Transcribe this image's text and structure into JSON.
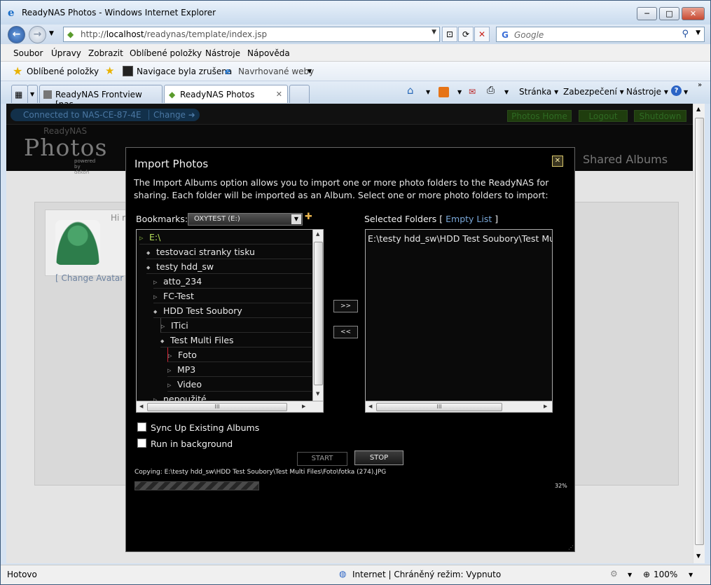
{
  "window": {
    "title": "ReadyNAS Photos - Windows Internet Explorer",
    "min": "─",
    "max": "□",
    "close": "✕"
  },
  "address": {
    "url_prefix": "http://",
    "url_host": "localhost",
    "url_path": "/readynas/template/index.jsp"
  },
  "search": {
    "placeholder": "Google"
  },
  "menu": [
    "Soubor",
    "Úpravy",
    "Zobrazit",
    "Oblíbené položky",
    "Nástroje",
    "Nápověda"
  ],
  "favorites": {
    "label": "Oblíbené položky",
    "items": [
      "Navigace byla zrušena",
      "Navrhované weby"
    ]
  },
  "tabs": [
    {
      "label": "ReadyNAS Frontview [nas-..."
    },
    {
      "label": "ReadyNAS Photos",
      "close": "✕"
    }
  ],
  "commands": [
    "Stránka",
    "Zabezpečení",
    "Nástroje"
  ],
  "nas": {
    "connected": "Connected to NAS-CE-87-4E",
    "change": "Change",
    "buttons": [
      "Photos Home",
      "Logout",
      "Shutdown"
    ],
    "logo_top": "ReadyNAS",
    "logo_main": "Photos",
    "powered": "powered by dekoh",
    "shared_albums": "Shared Albums",
    "hi": "Hi r",
    "change_avatar": "[ Change Avatar"
  },
  "dialog": {
    "title": "Import Photos",
    "close": "✕",
    "description": "The Import Albums option allows you to import one or more photo folders to the ReadyNAS for sharing. Each folder will be imported as an Album. Select one or more photo folders to import:",
    "bookmarks_label": "Bookmarks:",
    "bookmark_value": "OXYTEST (E:)",
    "selected_label": "Selected Folders [",
    "empty_list": "Empty List",
    "selected_close": "]",
    "tree": [
      "E:\\",
      "testovaci stranky tisku",
      "testy hdd_sw",
      "atto_234",
      "FC-Test",
      "HDD Test Soubory",
      "ITici",
      "Test Multi Files",
      "Foto",
      "MP3",
      "Video",
      "nepoužité"
    ],
    "selected_folders": [
      "E:\\testy hdd_sw\\HDD Test Soubory\\Test Multi Files\\Foto"
    ],
    "add_btn": ">>",
    "remove_btn": "<<",
    "sync_label": "Sync Up Existing Albums",
    "background_label": "Run in background",
    "start": "START",
    "stop": "STOP",
    "copying": "Copying: E:\\testy hdd_sw\\HDD Test Soubory\\Test Multi Files\\Foto\\fotka (274).JPG",
    "progress_percent": "32%",
    "progress_value": 0.32
  },
  "status": {
    "left": "Hotovo",
    "zone": "Internet | Chráněný režim: Vypnuto",
    "zoom": "100%"
  }
}
